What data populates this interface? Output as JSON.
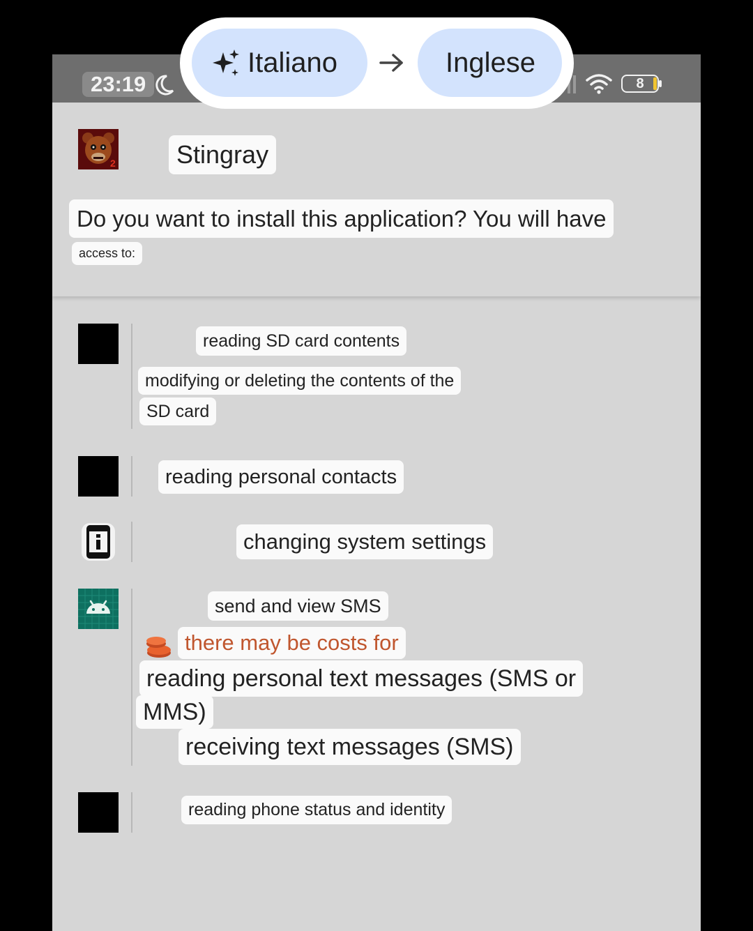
{
  "status_bar": {
    "time": "23:19",
    "battery_level": "8",
    "icons": [
      "moon-icon",
      "signal-icon",
      "wifi-icon",
      "battery-icon"
    ]
  },
  "app": {
    "name": "Stingray",
    "prompt_line1": "Do you want to install this application? You will have",
    "prompt_line2": "access to:"
  },
  "permissions": {
    "storage": {
      "icon": "black-square-icon",
      "line1": "reading SD card contents",
      "line2": "modifying or deleting the contents of the",
      "line3": "SD card"
    },
    "contacts": {
      "icon": "black-square-icon",
      "line1": "reading personal contacts"
    },
    "settings": {
      "icon": "phone-info-icon",
      "line1": "changing system settings"
    },
    "sms": {
      "icon": "android-icon",
      "line1": "send and view SMS",
      "cost_warning": "there may be costs for",
      "line2": "reading personal text messages (SMS or",
      "line3": "MMS)",
      "line4": "receiving text messages (SMS)"
    },
    "phone": {
      "icon": "black-square-icon",
      "line1": "reading phone status and identity"
    }
  },
  "translate_bar": {
    "source_lang": "Italiano",
    "target_lang": "Inglese",
    "colors": {
      "pill": "#d3e3fd",
      "warning_text": "#c0562e"
    }
  }
}
